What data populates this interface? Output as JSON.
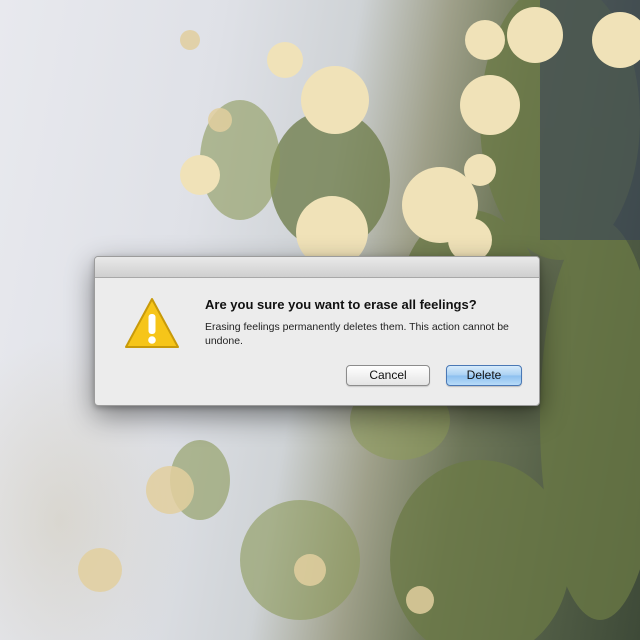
{
  "dialog": {
    "icon": "warning-triangle-icon",
    "heading": "Are you sure you want to erase all feelings?",
    "message": "Erasing feelings permanently deletes them. This action cannot be undone.",
    "buttons": {
      "cancel": "Cancel",
      "delete": "Delete"
    }
  },
  "colors": {
    "warning_yellow": "#f6c519",
    "default_button_blue": "#9fcaf2",
    "dialog_background": "#ececec"
  }
}
